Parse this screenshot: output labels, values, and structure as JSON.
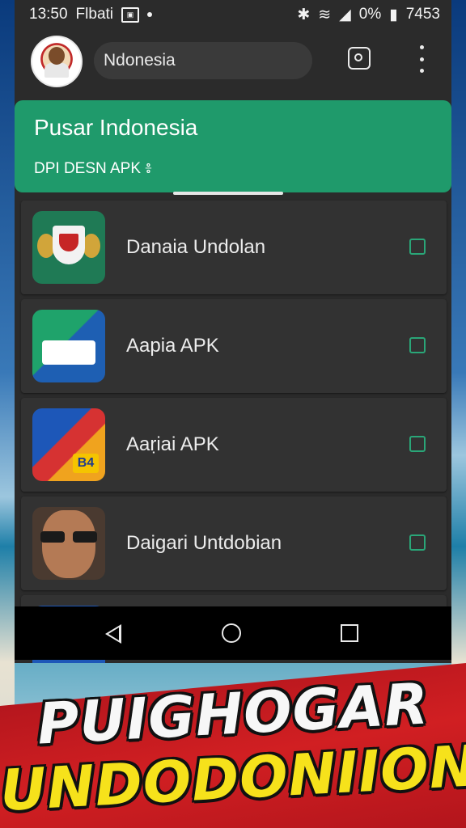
{
  "status_bar": {
    "time": "13:50",
    "carrier": "Flbati",
    "battery_percent": "0%",
    "right_text": "7453"
  },
  "topbar": {
    "search_value": "Ndonesia"
  },
  "banner": {
    "title": "Pusar Indonesia",
    "subtitle": "DPI DESN APK ៖"
  },
  "apps": [
    {
      "name": "Danaia Undolan",
      "icon": "garuda-emblem-icon",
      "checked": false
    },
    {
      "name": "Aapia APK",
      "icon": "green-blue-card-icon",
      "checked": false
    },
    {
      "name": "Aaṛiai APK",
      "icon": "b4-logo-icon",
      "checked": false
    },
    {
      "name": "Daigari Untdobian",
      "icon": "man-with-sunglasses-photo",
      "checked": false
    }
  ],
  "overlay_text": {
    "line1": "PUIGHOGAR",
    "line2": "UNDODONIION"
  },
  "colors": {
    "accent_green": "#1f9a6b",
    "checkbox_green": "#2aa678",
    "headline_yellow": "#f6e21b",
    "band_red": "#d11f22"
  }
}
